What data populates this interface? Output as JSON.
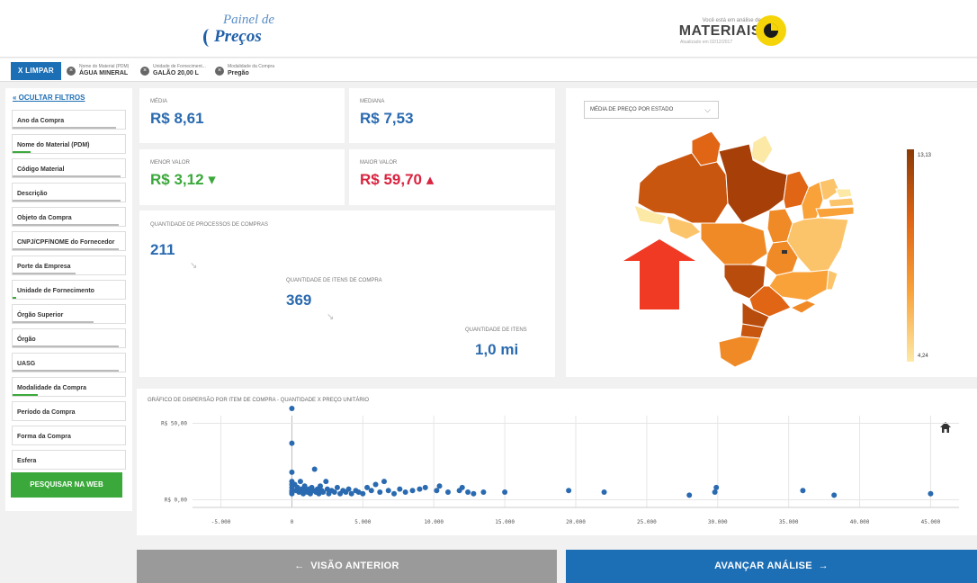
{
  "header": {
    "logo_line1": "Painel de",
    "logo_line2": "Preços",
    "analysis_caption": "Você está em análise de",
    "analysis_title": "MATERIAIS",
    "analysis_updated": "Atualizado em 02/12/2017",
    "analysis_icon": "pie-chart-icon"
  },
  "filterbar": {
    "clear_label": "X  LIMPAR",
    "chips": [
      {
        "label": "Nome do Material (PDM)",
        "value": "ÁGUA MINERAL"
      },
      {
        "label": "Unidade de Forneciment...",
        "value": "GALÃO 20,00 L"
      },
      {
        "label": "Modalidade da Compra",
        "value": "Pregão"
      }
    ]
  },
  "sidebar": {
    "hide_label": "OCULTAR FILTROS",
    "items": [
      {
        "label": "Ano da Compra"
      },
      {
        "label": "Nome do Material (PDM)"
      },
      {
        "label": "Código Material"
      },
      {
        "label": "Descrição"
      },
      {
        "label": "Objeto da Compra"
      },
      {
        "label": "CNPJ/CPF/NOME do Fornecedor"
      },
      {
        "label": "Porte da Empresa"
      },
      {
        "label": "Unidade de Fornecimento"
      },
      {
        "label": "Órgão Superior"
      },
      {
        "label": "Órgão"
      },
      {
        "label": "UASG"
      },
      {
        "label": "Modalidade da Compra"
      },
      {
        "label": "Período da Compra"
      },
      {
        "label": "Forma da Compra"
      },
      {
        "label": "Esfera"
      }
    ],
    "web_search_label": "PESQUISAR NA WEB"
  },
  "stats": {
    "media_label": "MÉDIA",
    "media_value": "R$ 8,61",
    "mediana_label": "MEDIANA",
    "mediana_value": "R$ 7,53",
    "menor_label": "MENOR VALOR",
    "menor_value": "R$ 3,12 ▾",
    "maior_label": "MAIOR VALOR",
    "maior_value": "R$ 59,70 ▴"
  },
  "quantities": {
    "processos_label": "QUANTIDADE DE PROCESSOS DE COMPRAS",
    "processos_value": "211",
    "itens_compra_label": "QUANTIDADE DE ITENS DE COMPRA",
    "itens_compra_value": "369",
    "itens_label": "QUANTIDADE DE ITENS",
    "itens_value": "1,0 mi"
  },
  "map": {
    "select_label": "MÉDIA DE PREÇO POR ESTADO",
    "legend_max": "13,13",
    "legend_min": "4,24",
    "colors": [
      "#8a3a07",
      "#b84c0d",
      "#e06514",
      "#f08a26",
      "#f9a23a",
      "#fcc46a",
      "#fde9a6"
    ]
  },
  "scatter": {
    "title": "GRÁFICO DE DISPERSÃO POR ITEM DE COMPRA - QUANTIDADE X PREÇO UNITÁRIO"
  },
  "chart_data": {
    "type": "scatter",
    "title": "GRÁFICO DE DISPERSÃO POR ITEM DE COMPRA - QUANTIDADE X PREÇO UNITÁRIO",
    "xlabel": "",
    "ylabel": "",
    "xlim": [
      -7000,
      47000
    ],
    "ylim": [
      -5,
      55
    ],
    "x_ticks": [
      "-5.000",
      "0",
      "5.000",
      "10.000",
      "15.000",
      "20.000",
      "25.000",
      "30.000",
      "35.000",
      "40.000",
      "45.000"
    ],
    "x_tick_values": [
      -5000,
      0,
      5000,
      10000,
      15000,
      20000,
      25000,
      30000,
      35000,
      40000,
      45000
    ],
    "y_ticks": [
      "R$ 50,00",
      "R$ 0,00"
    ],
    "y_tick_values": [
      50,
      0
    ],
    "points": [
      [
        0,
        59.7
      ],
      [
        0,
        37
      ],
      [
        0,
        18
      ],
      [
        0,
        12
      ],
      [
        0,
        10
      ],
      [
        0,
        8
      ],
      [
        0,
        6
      ],
      [
        0,
        5
      ],
      [
        0,
        4
      ],
      [
        200,
        10
      ],
      [
        300,
        6
      ],
      [
        400,
        8
      ],
      [
        500,
        5
      ],
      [
        600,
        12
      ],
      [
        700,
        7
      ],
      [
        800,
        4
      ],
      [
        900,
        9
      ],
      [
        1000,
        6
      ],
      [
        1100,
        5
      ],
      [
        1200,
        7
      ],
      [
        1300,
        4
      ],
      [
        1400,
        8
      ],
      [
        1500,
        6
      ],
      [
        1600,
        20
      ],
      [
        1700,
        5
      ],
      [
        1800,
        7
      ],
      [
        1900,
        4
      ],
      [
        2000,
        9
      ],
      [
        2100,
        6
      ],
      [
        2200,
        5
      ],
      [
        2400,
        12
      ],
      [
        2500,
        7
      ],
      [
        2600,
        4
      ],
      [
        2800,
        6
      ],
      [
        3000,
        5
      ],
      [
        3200,
        8
      ],
      [
        3400,
        4
      ],
      [
        3600,
        6
      ],
      [
        3800,
        5
      ],
      [
        4000,
        7
      ],
      [
        4200,
        4
      ],
      [
        4500,
        6
      ],
      [
        4700,
        5
      ],
      [
        5000,
        4
      ],
      [
        5300,
        8
      ],
      [
        5600,
        6
      ],
      [
        5900,
        10
      ],
      [
        6200,
        5
      ],
      [
        6500,
        12
      ],
      [
        6800,
        6
      ],
      [
        7200,
        4
      ],
      [
        7600,
        7
      ],
      [
        8000,
        5
      ],
      [
        8500,
        6
      ],
      [
        9000,
        7
      ],
      [
        9400,
        8
      ],
      [
        10200,
        6
      ],
      [
        10400,
        9
      ],
      [
        11000,
        5
      ],
      [
        11800,
        6
      ],
      [
        12000,
        8
      ],
      [
        12400,
        5
      ],
      [
        12800,
        4
      ],
      [
        13500,
        5
      ],
      [
        15000,
        5
      ],
      [
        19500,
        6
      ],
      [
        22000,
        5
      ],
      [
        28000,
        3
      ],
      [
        29800,
        5
      ],
      [
        29900,
        8
      ],
      [
        36000,
        6
      ],
      [
        38200,
        3
      ],
      [
        45000,
        4
      ]
    ]
  }
}
